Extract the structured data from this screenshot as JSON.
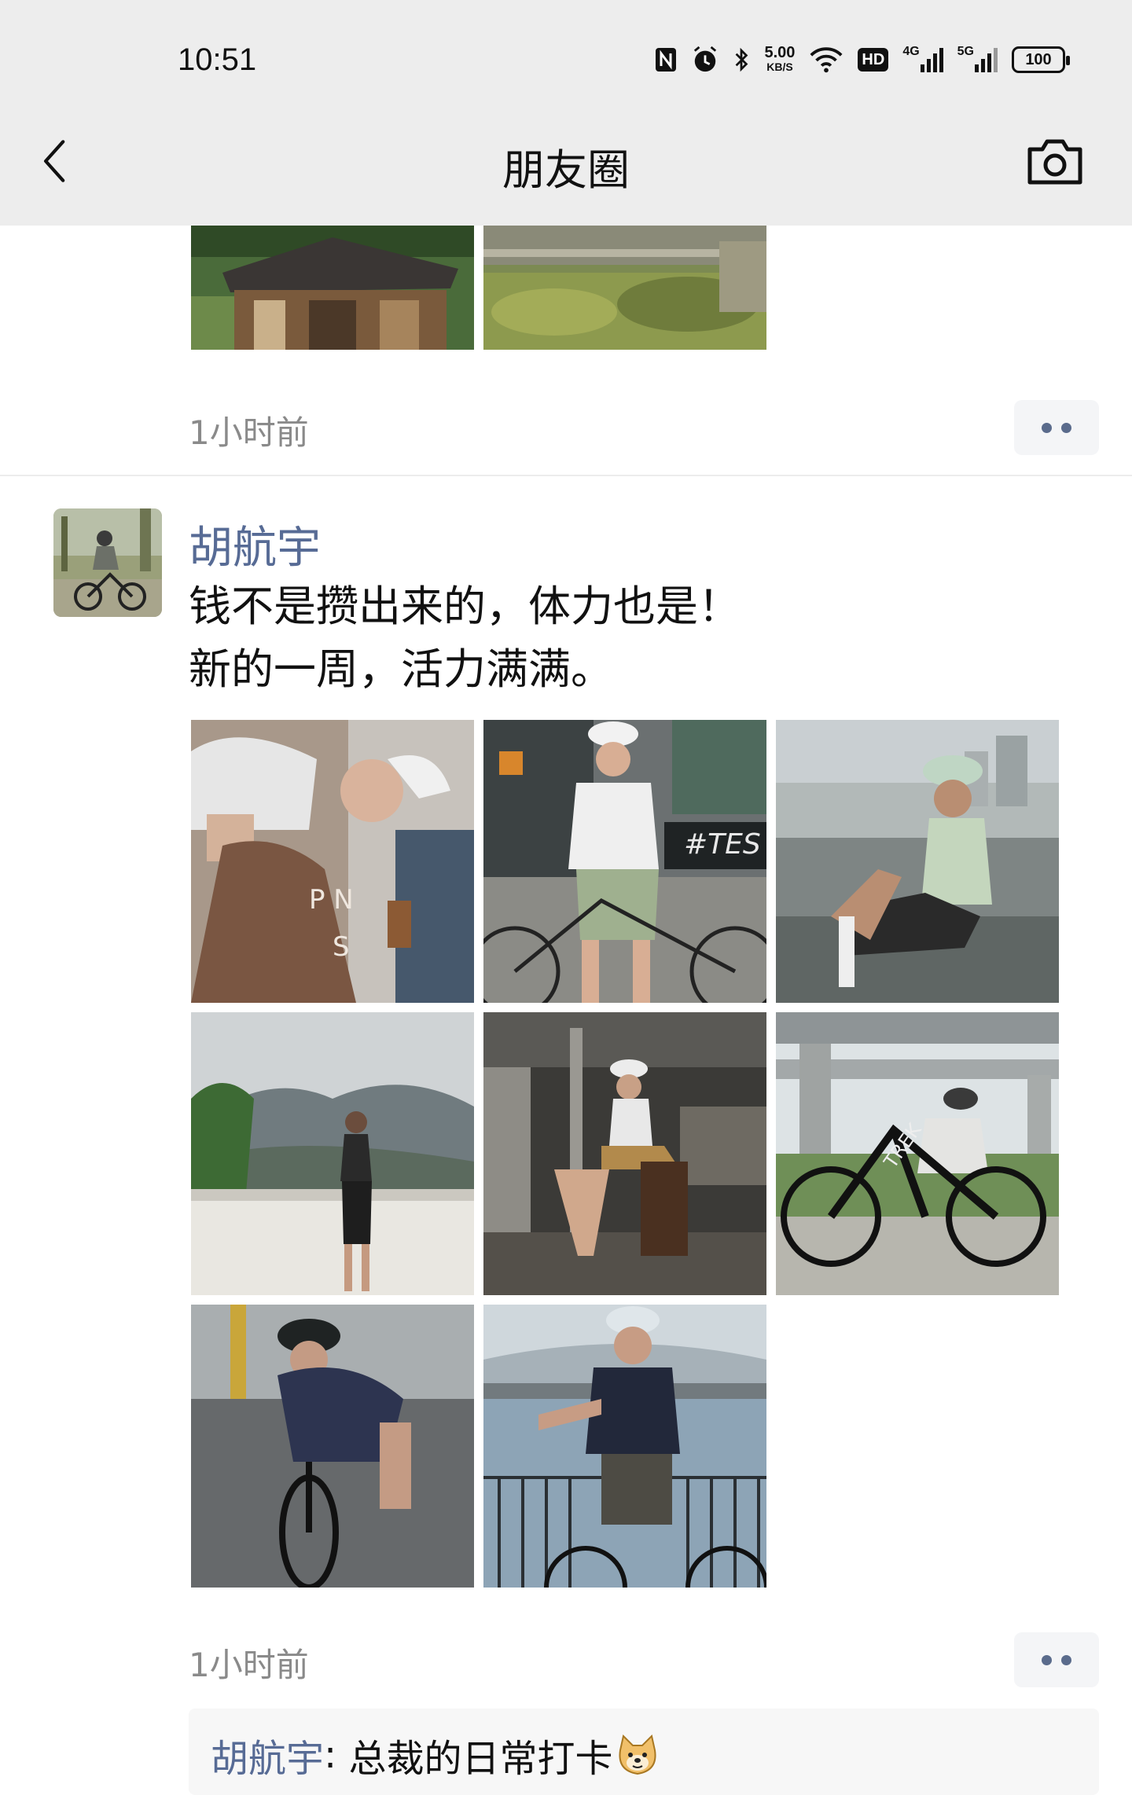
{
  "status_bar": {
    "time": "10:51",
    "net_speed_value": "5.00",
    "net_speed_unit": "KB/S",
    "hd_label": "HD",
    "signal1_label": "4G",
    "signal2_label": "5G",
    "battery": "100",
    "icons": [
      "nfc-icon",
      "alarm-icon",
      "bluetooth-icon",
      "wifi-icon",
      "signal-icon",
      "battery-icon"
    ]
  },
  "header": {
    "title": "朋友圈",
    "back_icon": "chevron-left-icon",
    "camera_icon": "camera-icon"
  },
  "previous_post": {
    "time": "1小时前",
    "images": [
      "building-photo",
      "moss-wall-photo"
    ]
  },
  "post": {
    "author": "胡航宇",
    "text": "钱不是攒出来的，体力也是！\n新的一周，活力满满。",
    "images": [
      "cyclists-coffee-photo",
      "cyclist-shop-photo",
      "cyclist-riverside-photo",
      "cyclist-mountain-photo",
      "cyclist-cafe-photo",
      "cyclist-bridge-photo",
      "cyclist-riding-photo",
      "cyclist-railing-photo"
    ],
    "time": "1小时前",
    "more_icon": "more-dots-icon",
    "comment": {
      "author": "胡航宇",
      "separator": ": ",
      "text": "总裁的日常打卡",
      "emoji": "doge-emoji-icon"
    }
  },
  "colors": {
    "link": "#576b95",
    "header_bg": "#ededed",
    "muted": "#8a8a8a"
  }
}
